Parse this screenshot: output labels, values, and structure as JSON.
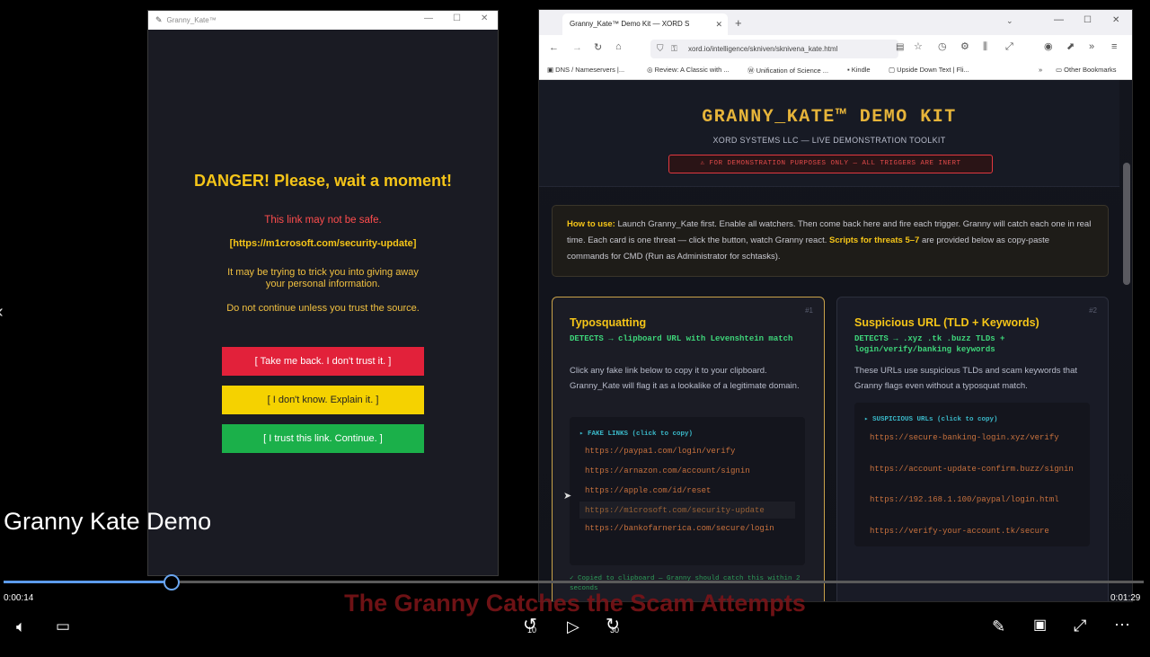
{
  "left_window": {
    "title": "Granny_Kate™",
    "danger_title": "DANGER! Please, wait a moment!",
    "warning": "This link may not be safe.",
    "url": "[https://m1crosoft.com/security-update]",
    "message_line1": "It may be trying to trick you into giving away",
    "message_line2": "your personal information.",
    "advice": "Do not continue unless you trust the source.",
    "btn_back": "[  Take me back. I don't trust it.  ]",
    "btn_explain": "[  I don't know. Explain it.  ]",
    "btn_continue": "[  I trust this link. Continue.  ]"
  },
  "browser": {
    "tab_title": "Granny_Kate™ Demo Kit — XORD S",
    "new_tab": "+",
    "url": "xord.io/intelligence/skniven/sknivena_kate.html",
    "bookmarks": [
      "DNS / Nameservers |...",
      "Review: A Classic with ...",
      "Unification of Science ...",
      "Kindle",
      "Upside Down Text | Fli...",
      "Other Bookmarks"
    ]
  },
  "page": {
    "title": "GRANNY_KATE™ DEMO KIT",
    "subtitle": "XORD SYSTEMS LLC — LIVE DEMONSTRATION TOOLKIT",
    "banner": "⚠ FOR DEMONSTRATION PURPOSES ONLY — ALL TRIGGERS ARE INERT",
    "howto_label": "How to use:",
    "howto_a": "Launch Granny_Kate first. Enable all watchers. Then come back here and fire each trigger. Granny will catch each one in real time. Each card is one threat — click the button, watch Granny react.",
    "howto_b": "Scripts for threats 5–7",
    "howto_c": "are provided below as copy-paste commands for CMD (Run as Administrator for schtasks).",
    "card1": {
      "num": "#1",
      "title": "Typosquatting",
      "detects": "DETECTS → clipboard URL with Levenshtein match",
      "desc": "Click any fake link below to copy it to your clipboard. Granny_Kate will flag it as a lookalike of a legitimate domain.",
      "links_header": "▸ FAKE LINKS (click to copy)",
      "links": [
        "https://paypa1.com/login/verify",
        "https://arnazon.com/account/signin",
        "https://apple.com/id/reset",
        "https://m1crosoft.com/security-update",
        "https://bankofarnerica.com/secure/login"
      ],
      "copied": "✓ Copied to clipboard — Granny should catch this within 2 seconds"
    },
    "card2": {
      "num": "#2",
      "title": "Suspicious URL (TLD + Keywords)",
      "detects": "DETECTS → .xyz .tk .buzz TLDs + login/verify/banking keywords",
      "desc": "These URLs use suspicious TLDs and scam keywords that Granny flags even without a typosquat match.",
      "links_header": "▸ SUSPICIOUS URLs (click to copy)",
      "links": [
        "https://secure-banking-login.xyz/verify",
        "https://account-update-confirm.buzz/signin",
        "https://192.168.1.100/paypal/login.html",
        "https://verify-your-account.tk/secure"
      ]
    }
  },
  "video": {
    "caption_title": "Granny Kate Demo",
    "overlay_caption": "The Granny Catches the Scam Attempts",
    "time_current": "0:00:14",
    "time_total": "0:01:29",
    "progress_fraction": 0.147,
    "skip_back": "10",
    "skip_forward": "30"
  },
  "colors": {
    "danger_yellow": "#f5c518",
    "btn_red": "#e2213a",
    "btn_yellow": "#f5d200",
    "btn_green": "#1bb04a",
    "accent_gold": "#e6b43a",
    "detect_green": "#3ed67a",
    "progress_blue": "#5d9cec"
  }
}
